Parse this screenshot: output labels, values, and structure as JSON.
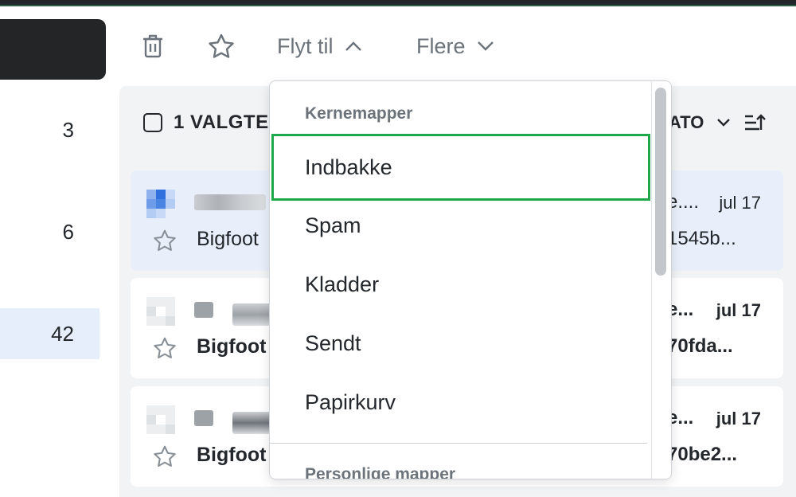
{
  "sidebar": {
    "counts": [
      "3",
      "6",
      "42"
    ]
  },
  "toolbar": {
    "move_label": "Flyt til",
    "more_label": "Flere"
  },
  "list": {
    "selected_label": "1 VALGTE",
    "sort_label": "ATO"
  },
  "emails": [
    {
      "sender": "Bigfoot",
      "subject_tail": "e....",
      "date": "jul 17",
      "preview_tail": "1545b...",
      "selected": true,
      "unread": false
    },
    {
      "sender": "Bigfoot",
      "subject_tail": "e...",
      "date": "jul 17",
      "preview_tail": "70fda...",
      "selected": false,
      "unread": true
    },
    {
      "sender": "Bigfoot",
      "subject_tail": "e...",
      "date": "jul 17",
      "preview_tail": "70be2...",
      "selected": false,
      "unread": true
    }
  ],
  "move_menu": {
    "group_core": "Kernemapper",
    "items": [
      "Indbakke",
      "Spam",
      "Kladder",
      "Sendt",
      "Papirkurv"
    ],
    "group_personal": "Personlige mapper",
    "focused_item": "Indbakke"
  },
  "colors": {
    "focus_ring": "#1ea84a",
    "selected_row": "#e8effb",
    "panel_bg": "#f1f3f5"
  }
}
